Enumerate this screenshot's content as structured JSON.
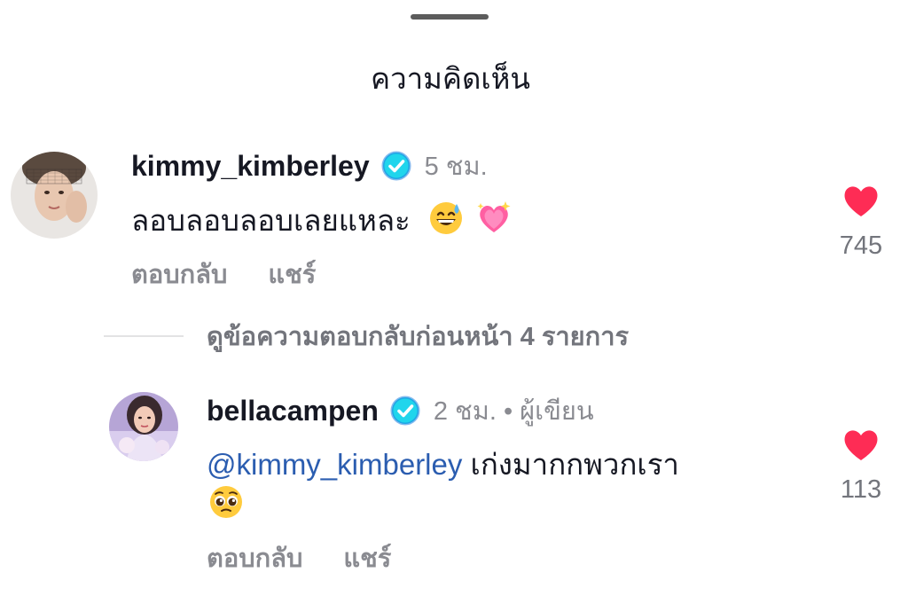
{
  "sheet": {
    "title": "ความคิดเห็น"
  },
  "comments": [
    {
      "username": "kimmy_kimberley",
      "verified": true,
      "time": "5 ชม.",
      "text": "ลอบลอบลอบเลยแหละ",
      "emojis": [
        "grinning-sweat-emoji",
        "sparkling-heart-emoji"
      ],
      "reply_label": "ตอบกลับ",
      "share_label": "แชร์",
      "likes": "745",
      "liked": true
    }
  ],
  "view_replies": {
    "label": "ดูข้อความตอบกลับก่อนหน้า 4 รายการ"
  },
  "replies": [
    {
      "username": "bellacampen",
      "verified": true,
      "time": "2 ชม. • ผู้เขียน",
      "mention": "@kimmy_kimberley",
      "text": " เก่งมากกพวกเรา",
      "emojis": [
        "pleading-face-emoji"
      ],
      "reply_label": "ตอบกลับ",
      "share_label": "แชร์",
      "likes": "113",
      "liked": true
    }
  ],
  "colors": {
    "accent_like": "#fe2c55",
    "verified": "#20d5ec",
    "mention": "#2b5db0",
    "muted": "#8a8b91"
  }
}
